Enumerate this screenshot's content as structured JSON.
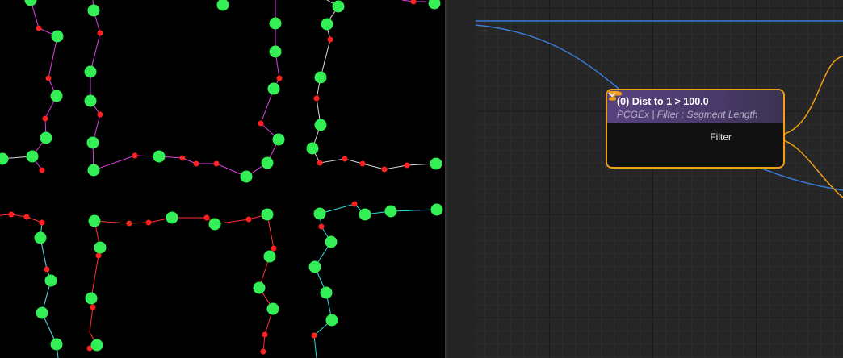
{
  "node": {
    "title": "(0) Dist to 1 > 100.0",
    "subtitle": "PCGEx | Filter : Segment Length",
    "output_pin_label": "Filter",
    "header_color": "#58427f",
    "border_color": "#f0a012"
  },
  "icons": {
    "filter": "filter-funnel-icon",
    "pin": "output-pin-icon",
    "expand": "chevron-down-icon"
  },
  "colors": {
    "vertex": "#33ee55",
    "point": "#ff2020",
    "edge_magenta": "#e040e0",
    "edge_white": "#d8d8d8",
    "edge_cyan": "#30e0e0",
    "edge_red": "#ff3030",
    "wire_blue": "#3a7bd5",
    "wire_orange": "#f0a012"
  }
}
